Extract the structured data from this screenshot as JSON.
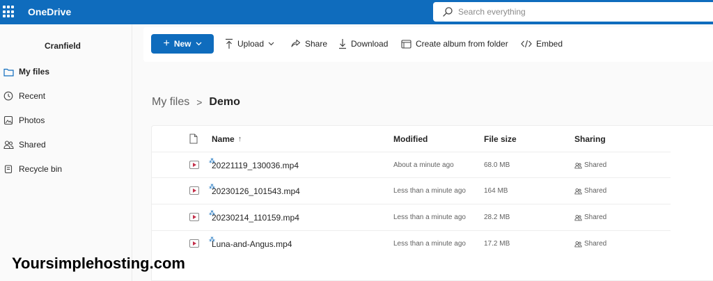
{
  "app": {
    "name": "OneDrive"
  },
  "search": {
    "placeholder": "Search everything"
  },
  "sidebar": {
    "tenant": "Cranfield",
    "items": [
      {
        "label": "My files",
        "icon": "folder-icon",
        "active": true
      },
      {
        "label": "Recent",
        "icon": "clock-icon",
        "active": false
      },
      {
        "label": "Photos",
        "icon": "image-icon",
        "active": false
      },
      {
        "label": "Shared",
        "icon": "people-icon",
        "active": false
      },
      {
        "label": "Recycle bin",
        "icon": "trash-icon",
        "active": false
      }
    ]
  },
  "toolbar": {
    "new_label": "New",
    "upload_label": "Upload",
    "share_label": "Share",
    "download_label": "Download",
    "album_label": "Create album from folder",
    "embed_label": "Embed"
  },
  "breadcrumb": {
    "parent": "My files",
    "separator": ">",
    "current": "Demo"
  },
  "table": {
    "columns": {
      "name": "Name",
      "sort_indicator": "↑",
      "modified": "Modified",
      "size": "File size",
      "sharing": "Sharing"
    },
    "rows": [
      {
        "name": "20221119_130036.mp4",
        "modified": "About a minute ago",
        "size": "68.0 MB",
        "sharing": "Shared"
      },
      {
        "name": "20230126_101543.mp4",
        "modified": "Less than a minute ago",
        "size": "164 MB",
        "sharing": "Shared"
      },
      {
        "name": "20230214_110159.mp4",
        "modified": "Less than a minute ago",
        "size": "28.2 MB",
        "sharing": "Shared"
      },
      {
        "name": "Luna-and-Angus.mp4",
        "modified": "Less than a minute ago",
        "size": "17.2 MB",
        "sharing": "Shared"
      }
    ]
  },
  "watermark": {
    "text": "Yoursimplehosting.com"
  },
  "colors": {
    "brand": "#0f6cbd",
    "video_icon": "#c4314b"
  }
}
